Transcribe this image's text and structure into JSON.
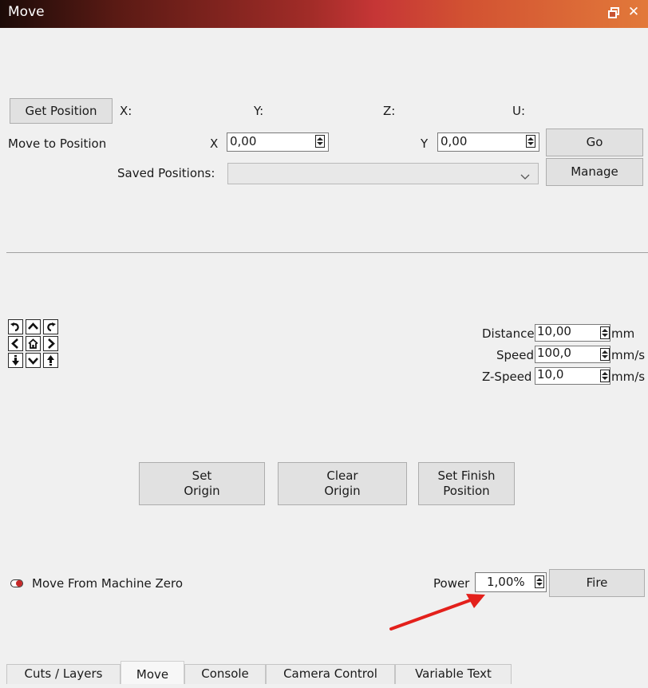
{
  "window": {
    "title": "Move"
  },
  "position": {
    "get_button": "Get Position",
    "x_label": "X:",
    "y_label": "Y:",
    "z_label": "Z:",
    "u_label": "U:"
  },
  "move_to": {
    "label": "Move to Position",
    "x_label": "X",
    "x_value": "0,00",
    "y_label": "Y",
    "y_value": "0,00",
    "go_button": "Go"
  },
  "saved": {
    "label": "Saved Positions:",
    "value": "",
    "manage_button": "Manage"
  },
  "jog_params": {
    "distance_label": "Distance",
    "distance_value": "10,00",
    "distance_unit": "mm",
    "speed_label": "Speed",
    "speed_value": "100,0",
    "speed_unit": "mm/s",
    "zspeed_label": "Z-Speed",
    "zspeed_value": "10,0",
    "zspeed_unit": "mm/s"
  },
  "origin": {
    "set_origin": "Set\nOrigin",
    "clear_origin": "Clear\nOrigin",
    "set_finish": "Set Finish\nPosition"
  },
  "machine_zero": {
    "label": "Move From Machine Zero",
    "enabled": false
  },
  "fire": {
    "power_label": "Power",
    "power_value": "1,00%",
    "fire_button": "Fire"
  },
  "tabs": [
    "Cuts / Layers",
    "Move",
    "Console",
    "Camera Control",
    "Variable Text"
  ],
  "active_tab": "Move",
  "colors": {
    "annotation_arrow": "#e3201b",
    "toggle_knob": "#c62828"
  }
}
